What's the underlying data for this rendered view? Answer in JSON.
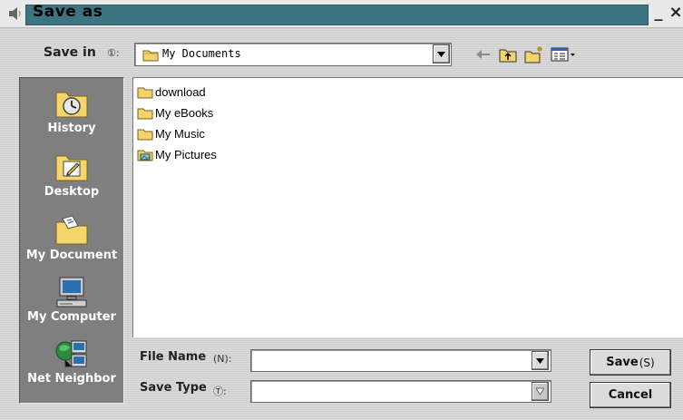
{
  "window": {
    "title": "Save as",
    "minimize_label": "_",
    "close_label": "×",
    "title_icon": "speaker-icon"
  },
  "save_in": {
    "label": "Save in",
    "shortcut": "①:",
    "value": "My Documents",
    "toolbar_icons": [
      "back-arrow-icon",
      "up-folder-icon",
      "new-folder-icon",
      "view-menu-icon"
    ]
  },
  "places": [
    {
      "label": "History",
      "icon": "history-icon"
    },
    {
      "label": "Desktop",
      "icon": "desktop-icon"
    },
    {
      "label": "My Document",
      "icon": "my-documents-icon"
    },
    {
      "label": "My Computer",
      "icon": "computer-icon"
    },
    {
      "label": "Net Neighbor",
      "icon": "network-icon"
    }
  ],
  "files": [
    {
      "name": "download",
      "icon": "folder-icon"
    },
    {
      "name": "My eBooks",
      "icon": "folder-icon"
    },
    {
      "name": "My Music",
      "icon": "folder-icon"
    },
    {
      "name": "My Pictures",
      "icon": "pictures-folder-icon"
    }
  ],
  "file_name": {
    "label": "File Name",
    "shortcut": "(N):",
    "value": ""
  },
  "save_type": {
    "label": "Save Type",
    "shortcut": "Ⓣ:",
    "value": ""
  },
  "buttons": {
    "save_label": "Save",
    "save_shortcut": "(S)",
    "cancel_label": "Cancel"
  },
  "colors": {
    "title_bar": "#3c7482",
    "places_bar": "#7f7f7f",
    "dialog_bg": "#d4d4d4"
  }
}
